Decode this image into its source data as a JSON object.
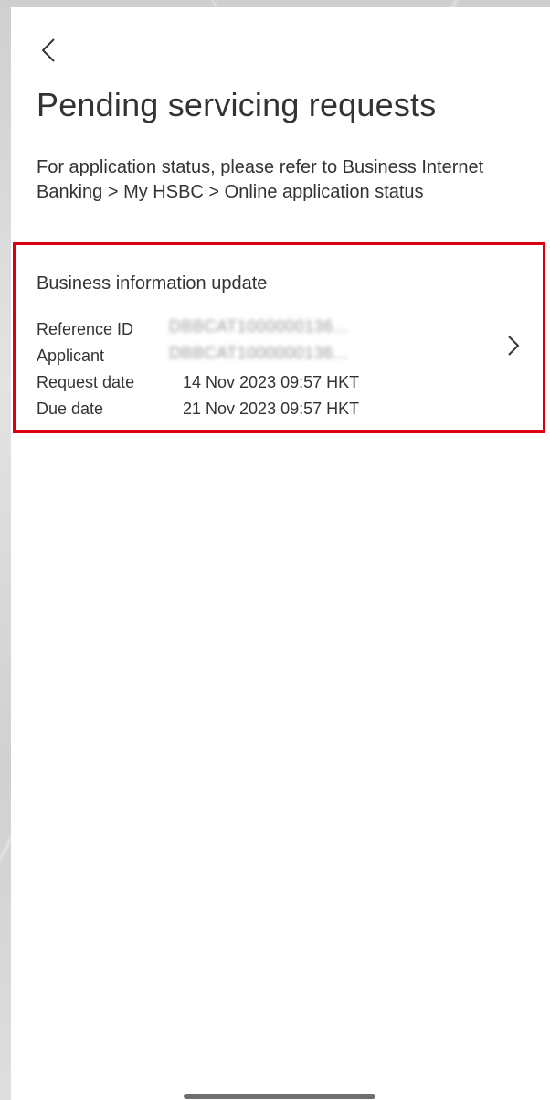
{
  "header": {
    "back_icon": "chevron-left-icon",
    "title": "Pending servicing requests"
  },
  "intro": {
    "text": "For application status, please refer to Business Internet Banking > My HSBC > Online application status"
  },
  "request_card": {
    "title": "Business information update",
    "highlight_color": "#db0011",
    "chevron_icon": "chevron-right-icon",
    "rows": [
      {
        "label": "Reference ID",
        "value": "DBBCAT1000000136...",
        "obscured": true
      },
      {
        "label": "Applicant",
        "value": "DBBCAT1000000136...",
        "obscured": true
      },
      {
        "label": "Request date",
        "value": "14 Nov 2023 09:57 HKT",
        "obscured": false
      },
      {
        "label": "Due date",
        "value": "21 Nov 2023 09:57 HKT",
        "obscured": false
      }
    ]
  }
}
